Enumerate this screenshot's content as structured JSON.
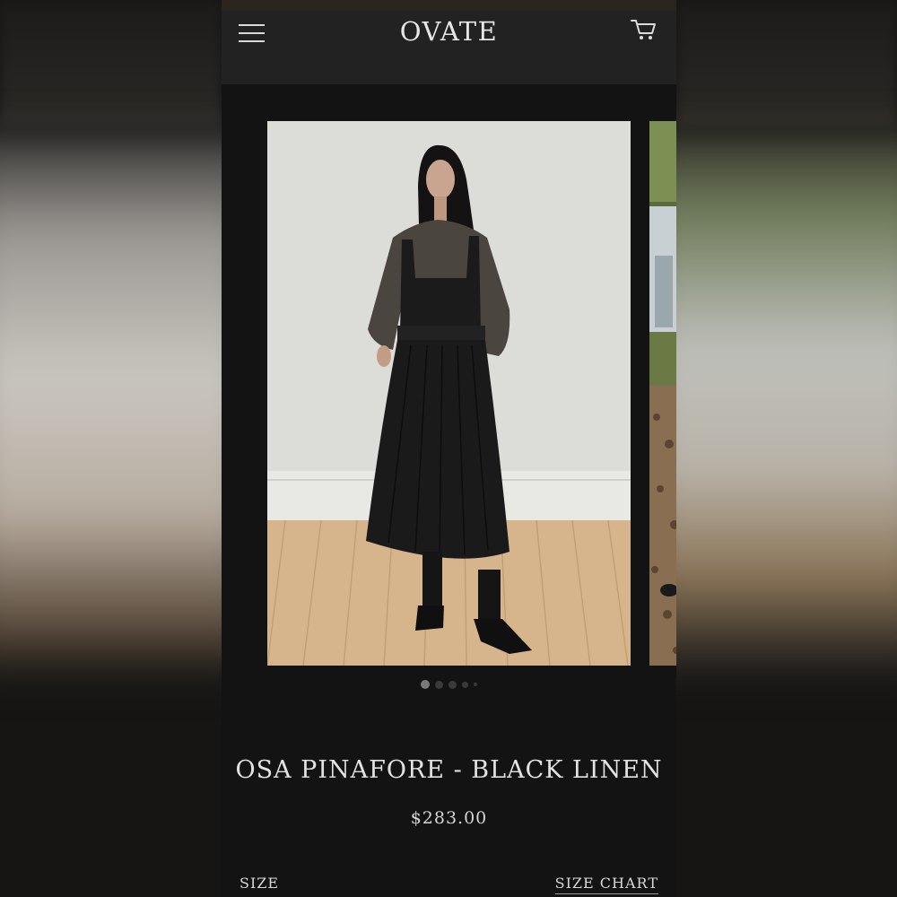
{
  "header": {
    "brand": "OVATE",
    "menu_icon": "hamburger-menu-icon",
    "cart_icon": "shopping-cart-icon"
  },
  "gallery": {
    "slides": [
      "model-front-photo",
      "model-outdoor-photo"
    ],
    "dot_count": 5,
    "active_index": 0
  },
  "product": {
    "title": "OSA PINAFORE - BLACK LINEN",
    "price": "$283.00",
    "size_label": "SIZE",
    "size_chart_label": "SIZE CHART"
  },
  "colors": {
    "background": "#131313",
    "header": "#222222",
    "text": "#e2e2e2"
  }
}
